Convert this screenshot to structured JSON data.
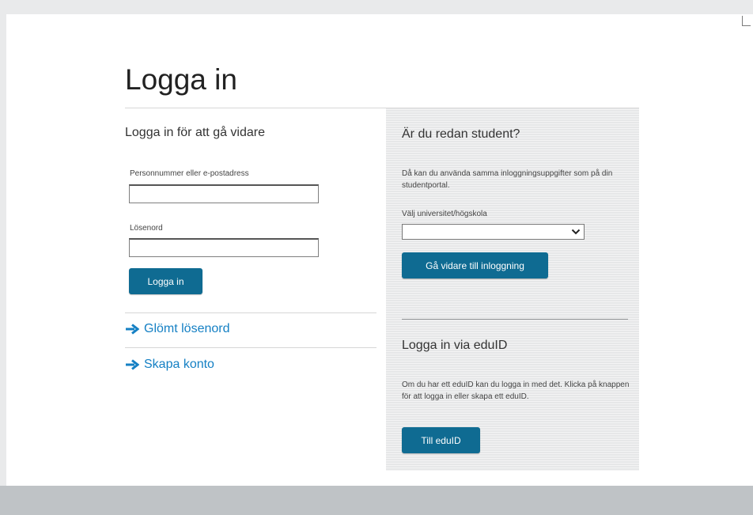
{
  "page": {
    "title": "Logga in"
  },
  "login": {
    "heading": "Logga in för att gå vidare",
    "username_label": "Personnummer eller e-postadress",
    "username_value": "",
    "password_label": "Lösenord",
    "password_value": "",
    "submit_label": "Logga in"
  },
  "links": {
    "forgot_password": "Glömt lösenord",
    "create_account": "Skapa konto"
  },
  "student": {
    "heading": "Är du redan student?",
    "text": "Då kan du använda samma inloggningsuppgifter som på din studentportal.",
    "select_label": "Välj universitet/högskola",
    "select_value": "",
    "button_label": "Gå vidare till inloggning"
  },
  "eduid": {
    "heading": "Logga in via eduID",
    "text": "Om du har ett eduID kan du logga in med det. Klicka på knappen för att logga in eller skapa ett eduID.",
    "button_label": "Till eduID"
  },
  "icons": {
    "link_arrow": "arrow-right-icon",
    "select_chevron": "chevron-down-icon"
  },
  "colors": {
    "primary_button": "#0f6b92",
    "link": "#1580c4",
    "panel_background": "#e6e7e8",
    "footer": "#bfc3c6"
  }
}
